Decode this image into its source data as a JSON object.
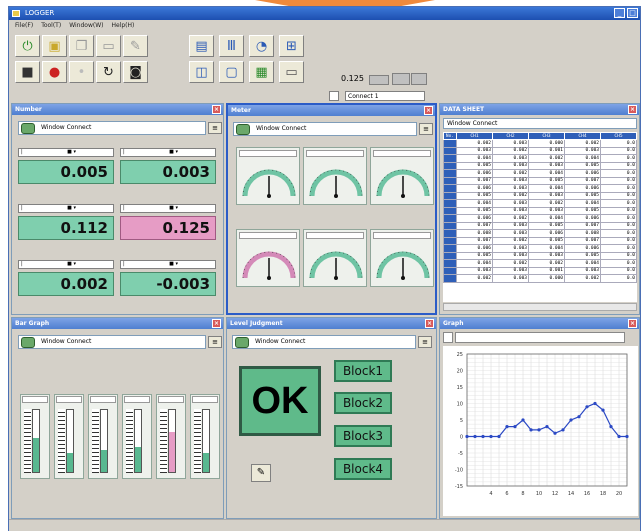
{
  "window": {
    "title": "LOGGER"
  },
  "menu": [
    "File(F)",
    "Tool(T)",
    "Window(W)",
    "Help(H)"
  ],
  "toolbar": {
    "value": "0.125",
    "text_field": "Connect 1"
  },
  "panels": {
    "numeric": {
      "title": "Number",
      "window_select": "Window Connect",
      "displays": [
        {
          "value": "0.005",
          "color": "green"
        },
        {
          "value": "0.003",
          "color": "green"
        },
        {
          "value": "0.112",
          "color": "green"
        },
        {
          "value": "0.125",
          "color": "pink"
        },
        {
          "value": "0.002",
          "color": "green"
        },
        {
          "value": "-0.003",
          "color": "green"
        }
      ]
    },
    "meter": {
      "title": "Meter",
      "window_select": "Window Connect",
      "gauges": [
        0.5,
        0.5,
        0.5,
        0.5,
        0.5,
        0.5
      ]
    },
    "data_sheet": {
      "title": "DATA SHEET",
      "window_select": "Window Connect",
      "headers": [
        "No.",
        "CH1",
        "CH2",
        "CH3",
        "CH4",
        "CH5"
      ],
      "rows": [
        [
          "0.002",
          "0.003",
          "0.000",
          "0.002",
          "0.0"
        ],
        [
          "0.003",
          "0.002",
          "0.001",
          "0.003",
          "0.0"
        ],
        [
          "0.004",
          "0.003",
          "0.002",
          "0.004",
          "0.0"
        ],
        [
          "0.005",
          "0.003",
          "0.003",
          "0.005",
          "0.0"
        ],
        [
          "0.006",
          "0.002",
          "0.004",
          "0.006",
          "0.0"
        ],
        [
          "0.007",
          "0.003",
          "0.005",
          "0.007",
          "0.0"
        ],
        [
          "0.006",
          "0.003",
          "0.004",
          "0.006",
          "0.0"
        ],
        [
          "0.005",
          "0.002",
          "0.003",
          "0.005",
          "0.0"
        ],
        [
          "0.004",
          "0.003",
          "0.002",
          "0.004",
          "0.0"
        ],
        [
          "0.005",
          "0.003",
          "0.003",
          "0.005",
          "0.0"
        ],
        [
          "0.006",
          "0.002",
          "0.004",
          "0.006",
          "0.0"
        ],
        [
          "0.007",
          "0.003",
          "0.005",
          "0.007",
          "0.0"
        ],
        [
          "0.008",
          "0.003",
          "0.006",
          "0.008",
          "0.0"
        ],
        [
          "0.007",
          "0.002",
          "0.005",
          "0.007",
          "0.0"
        ],
        [
          "0.006",
          "0.003",
          "0.004",
          "0.006",
          "0.0"
        ],
        [
          "0.005",
          "0.003",
          "0.003",
          "0.005",
          "0.0"
        ],
        [
          "0.004",
          "0.002",
          "0.002",
          "0.004",
          "0.0"
        ],
        [
          "0.003",
          "0.003",
          "0.001",
          "0.003",
          "0.0"
        ],
        [
          "0.002",
          "0.003",
          "0.000",
          "0.002",
          "0.0"
        ]
      ]
    },
    "bar_graph": {
      "title": "Bar Graph",
      "window_select": "Window Connect",
      "levels": [
        0.55,
        0.3,
        0.35,
        0.4,
        0.65,
        0.3
      ]
    },
    "judgment": {
      "title": "Level Judgment",
      "window_select": "Window Connect",
      "ok_label": "OK",
      "blocks": [
        "Block1",
        "Block2",
        "Block3",
        "Block4"
      ]
    },
    "graph": {
      "title": "Graph"
    }
  },
  "chart_data": {
    "type": "line",
    "x": [
      1,
      2,
      3,
      4,
      5,
      6,
      7,
      8,
      9,
      10,
      11,
      12,
      13,
      14,
      15,
      16,
      17,
      18,
      19,
      20,
      21
    ],
    "values": [
      0,
      0,
      0,
      0,
      0,
      3,
      3,
      5,
      2,
      2,
      3,
      1,
      2,
      5,
      6,
      9,
      10,
      8,
      3,
      0,
      0
    ],
    "xticks": [
      "4",
      "6",
      "8",
      "10",
      "12",
      "14",
      "16",
      "18",
      "20"
    ],
    "yticks": [
      "25",
      "20",
      "15",
      "10",
      "5",
      "0",
      "-5",
      "-10",
      "-15"
    ],
    "xlim": [
      1,
      21
    ],
    "ylim": [
      -15,
      25
    ],
    "color": "#2b49c4"
  }
}
